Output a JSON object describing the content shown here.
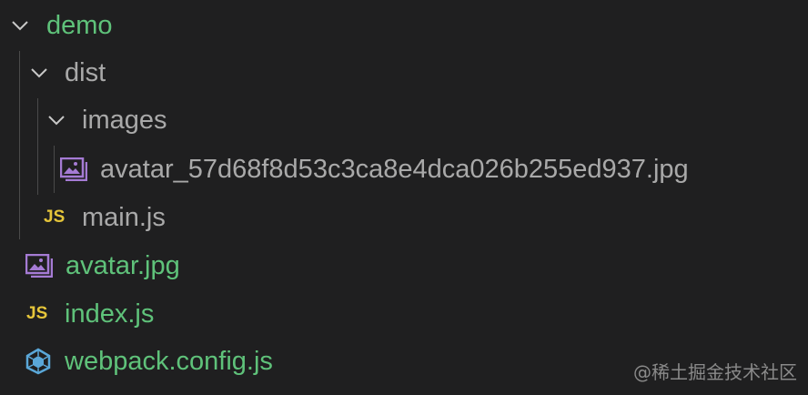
{
  "tree": {
    "root": {
      "label": "demo",
      "expanded": true,
      "color": "#5fc27a"
    },
    "dist": {
      "label": "dist",
      "expanded": true,
      "color": "#a9a9a9"
    },
    "images": {
      "label": "images",
      "expanded": true,
      "color": "#a9a9a9"
    },
    "image_file": {
      "label": "avatar_57d68f8d53c3ca8e4dca026b255ed937.jpg",
      "icon": "image-file-icon",
      "color": "#a9a9a9"
    },
    "main_js": {
      "label": "main.js",
      "icon": "js-file-icon",
      "color": "#a9a9a9"
    },
    "avatar": {
      "label": "avatar.jpg",
      "icon": "image-file-icon",
      "color": "#5fc27a"
    },
    "index_js": {
      "label": "index.js",
      "icon": "js-file-icon",
      "color": "#5fc27a"
    },
    "webpack": {
      "label": "webpack.config.js",
      "icon": "webpack-icon",
      "color": "#5fc27a"
    }
  },
  "icons": {
    "js_text": "JS",
    "js_color": "#e5c53a",
    "image_color": "#a57bd4",
    "webpack_color": "#5aa7d8"
  },
  "watermark": "@稀土掘金技术社区"
}
